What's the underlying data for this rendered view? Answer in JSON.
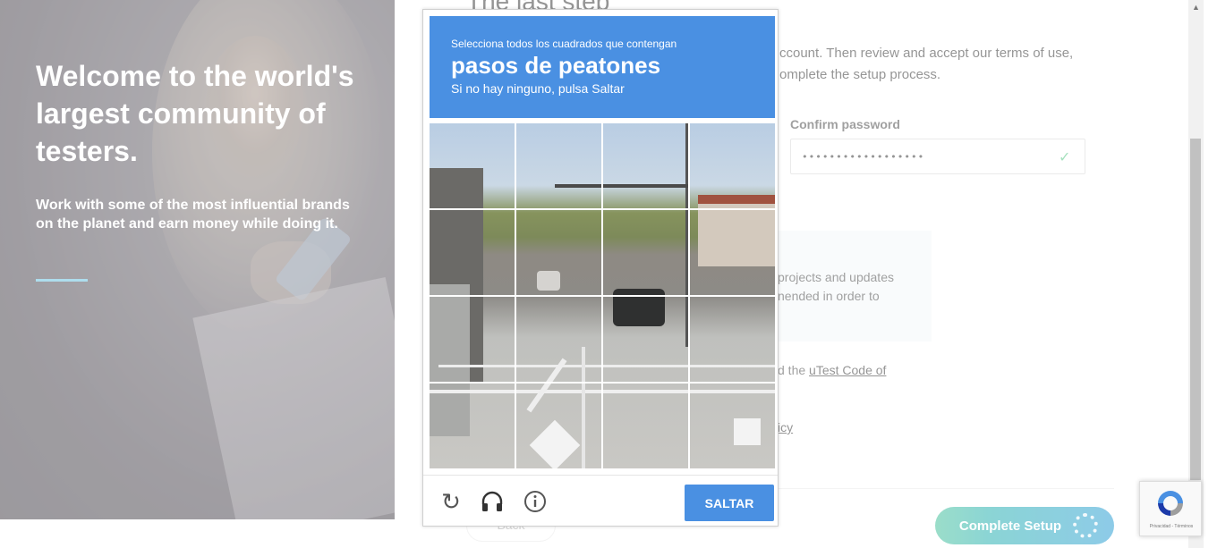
{
  "hero": {
    "title": "Welcome to the world's largest community of testers.",
    "subtitle": "Work with some of the most influential brands on the planet and earn money while doing it."
  },
  "form": {
    "heading": "The last step",
    "intro": "ccount. Then review and accept our terms of use, omplete the setup process.",
    "confirm_label": "Confirm password",
    "confirm_value": "••••••••••••••••••",
    "info_text": "projects and updates nended in order to",
    "code_prefix": "d the ",
    "code_link": "uTest Code of",
    "policy_text": "icy",
    "back_label": "Back",
    "complete_label": "Complete Setup"
  },
  "captcha": {
    "instruction": "Selecciona todos los cuadrados que contengan",
    "target": "pasos de peatones",
    "hint": "Si no hay ninguno, pulsa Saltar",
    "skip_label": "SALTAR",
    "icons": [
      "reload-icon",
      "headphones-icon",
      "info-icon"
    ],
    "grid": {
      "rows": 4,
      "cols": 4
    },
    "header_color": "#4a90e2"
  },
  "badge": {
    "text": "Privacidad - Términos"
  },
  "colors": {
    "accent": "#4a90e2",
    "hero_rule": "#7cc8e3",
    "check": "#6fcf97"
  }
}
